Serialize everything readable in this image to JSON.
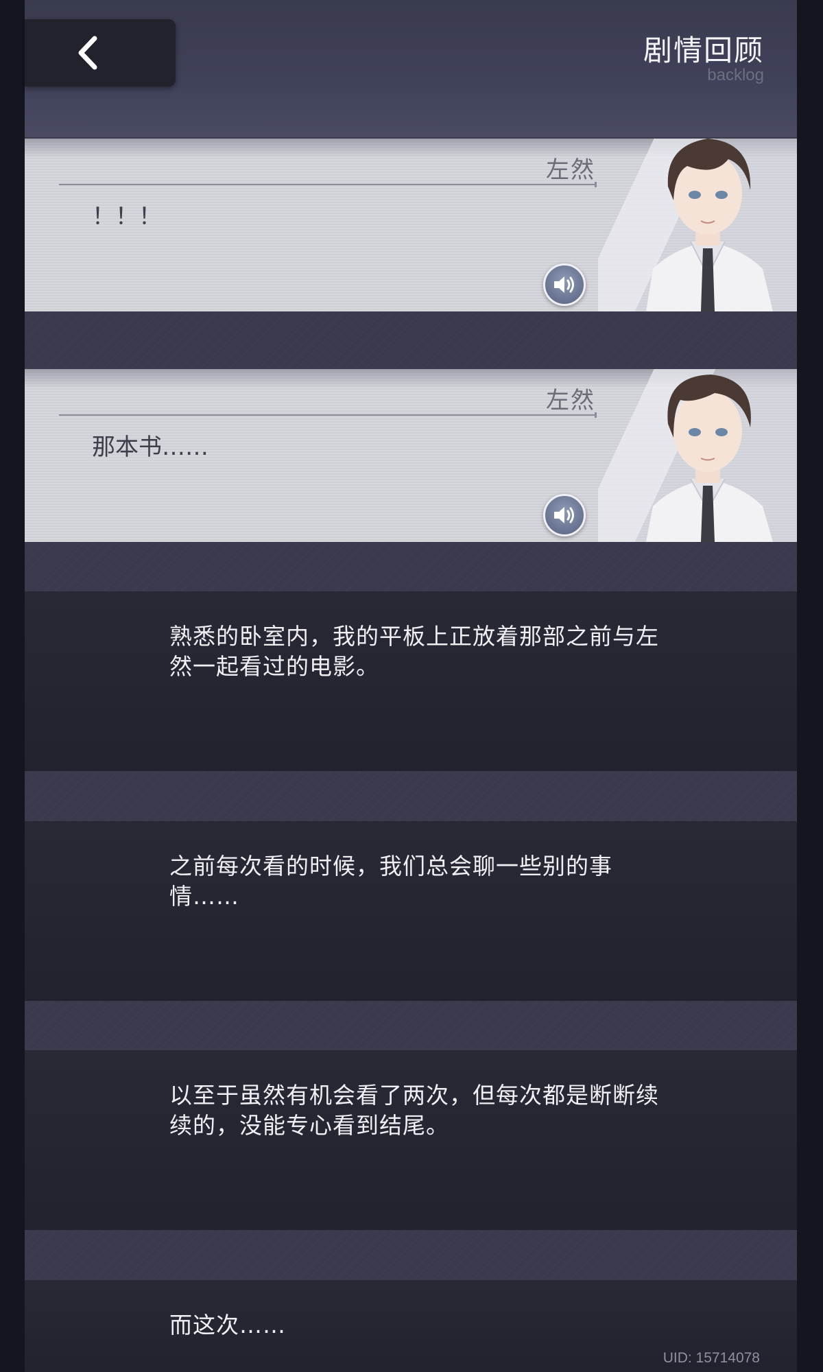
{
  "header": {
    "title": "剧情回顾",
    "subtitle": "backlog"
  },
  "entries": [
    {
      "type": "dialogue",
      "speaker": "左然",
      "text": "！！！"
    },
    {
      "type": "dialogue",
      "speaker": "左然",
      "text": "那本书……"
    },
    {
      "type": "narration",
      "text": "熟悉的卧室内，我的平板上正放着那部之前与左然一起看过的电影。"
    },
    {
      "type": "narration",
      "text": "之前每次看的时候，我们总会聊一些别的事情……"
    },
    {
      "type": "narration",
      "text": "以至于虽然有机会看了两次，但每次都是断断续续的，没能专心看到结尾。"
    },
    {
      "type": "narration",
      "text": "而这次……"
    }
  ],
  "footer": {
    "uid": "UID: 15714078"
  },
  "icons": {
    "back": "chevron-left-icon",
    "voice": "speaker-icon"
  }
}
